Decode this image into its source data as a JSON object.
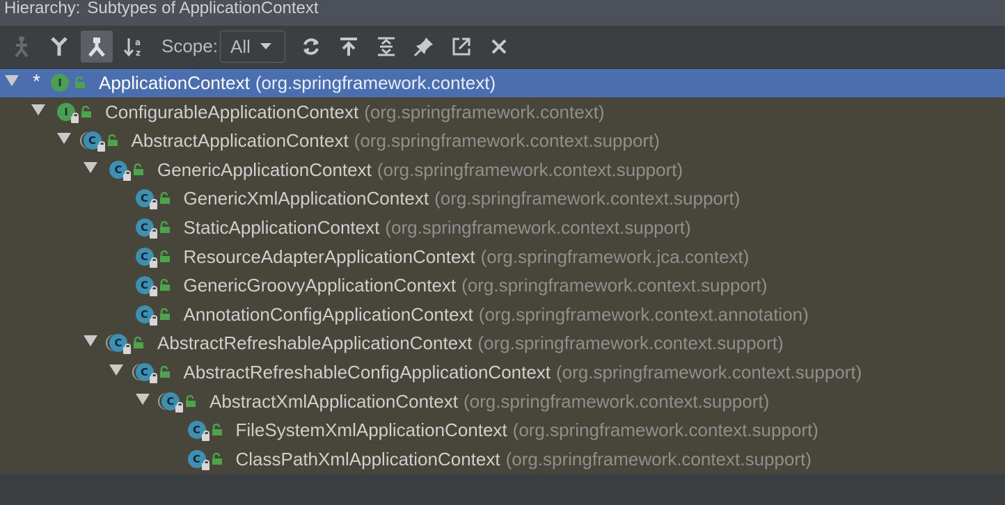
{
  "window": {
    "title_label": "Hierarchy:",
    "title_value": "Subtypes of ApplicationContext"
  },
  "toolbar": {
    "buttons": [
      {
        "icon": "type-hierarchy-icon"
      },
      {
        "icon": "supertypes-hierarchy-icon"
      },
      {
        "icon": "subtypes-hierarchy-icon"
      },
      {
        "icon": "sort-alphabetically-icon"
      }
    ],
    "scope_label": "Scope:",
    "scope_value": "All",
    "actions": [
      {
        "icon": "refresh-icon"
      },
      {
        "icon": "base-on-this-class-icon"
      },
      {
        "icon": "expand-all-icon"
      },
      {
        "icon": "pin-tab-icon"
      },
      {
        "icon": "export-icon"
      },
      {
        "icon": "close-icon"
      }
    ]
  },
  "colors": {
    "selection": "#4b6eaf",
    "tree_bg": "#48453a",
    "interface_icon": "#4a9e56",
    "class_icon": "#3e8fb0"
  },
  "tree": [
    {
      "depth": 0,
      "expanded": true,
      "marker": "*",
      "kind": "interface",
      "abstract": false,
      "locked": false,
      "name": "ApplicationContext",
      "package": "(org.springframework.context)",
      "selected": true
    },
    {
      "depth": 1,
      "expanded": true,
      "marker": "",
      "kind": "interface",
      "abstract": false,
      "locked": true,
      "name": "ConfigurableApplicationContext",
      "package": "(org.springframework.context)",
      "selected": false
    },
    {
      "depth": 2,
      "expanded": true,
      "marker": "",
      "kind": "class",
      "abstract": true,
      "locked": true,
      "name": "AbstractApplicationContext",
      "package": "(org.springframework.context.support)",
      "selected": false
    },
    {
      "depth": 3,
      "expanded": true,
      "marker": "",
      "kind": "class",
      "abstract": false,
      "locked": true,
      "name": "GenericApplicationContext",
      "package": "(org.springframework.context.support)",
      "selected": false
    },
    {
      "depth": 4,
      "expanded": false,
      "marker": "",
      "kind": "class",
      "abstract": false,
      "locked": true,
      "name": "GenericXmlApplicationContext",
      "package": "(org.springframework.context.support)",
      "selected": false
    },
    {
      "depth": 4,
      "expanded": false,
      "marker": "",
      "kind": "class",
      "abstract": false,
      "locked": true,
      "name": "StaticApplicationContext",
      "package": "(org.springframework.context.support)",
      "selected": false
    },
    {
      "depth": 4,
      "expanded": false,
      "marker": "",
      "kind": "class",
      "abstract": false,
      "locked": true,
      "name": "ResourceAdapterApplicationContext",
      "package": "(org.springframework.jca.context)",
      "selected": false
    },
    {
      "depth": 4,
      "expanded": false,
      "marker": "",
      "kind": "class",
      "abstract": false,
      "locked": true,
      "name": "GenericGroovyApplicationContext",
      "package": "(org.springframework.context.support)",
      "selected": false
    },
    {
      "depth": 4,
      "expanded": false,
      "marker": "",
      "kind": "class",
      "abstract": false,
      "locked": true,
      "name": "AnnotationConfigApplicationContext",
      "package": "(org.springframework.context.annotation)",
      "selected": false
    },
    {
      "depth": 3,
      "expanded": true,
      "marker": "",
      "kind": "class",
      "abstract": true,
      "locked": true,
      "name": "AbstractRefreshableApplicationContext",
      "package": "(org.springframework.context.support)",
      "selected": false
    },
    {
      "depth": 4,
      "expanded": true,
      "marker": "",
      "kind": "class",
      "abstract": true,
      "locked": true,
      "name": "AbstractRefreshableConfigApplicationContext",
      "package": "(org.springframework.context.support)",
      "selected": false
    },
    {
      "depth": 5,
      "expanded": true,
      "marker": "",
      "kind": "class",
      "abstract": true,
      "locked": true,
      "name": "AbstractXmlApplicationContext",
      "package": "(org.springframework.context.support)",
      "selected": false
    },
    {
      "depth": 6,
      "expanded": false,
      "marker": "",
      "kind": "class",
      "abstract": false,
      "locked": true,
      "name": "FileSystemXmlApplicationContext",
      "package": "(org.springframework.context.support)",
      "selected": false
    },
    {
      "depth": 6,
      "expanded": false,
      "marker": "",
      "kind": "class",
      "abstract": false,
      "locked": true,
      "name": "ClassPathXmlApplicationContext",
      "package": "(org.springframework.context.support)",
      "selected": false
    }
  ]
}
